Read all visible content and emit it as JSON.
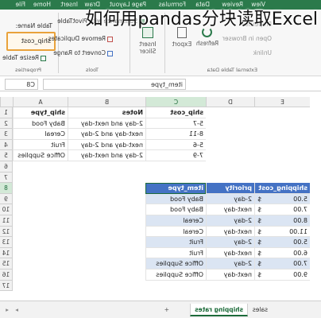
{
  "ribbon": {
    "tabs": [
      "File",
      "Home",
      "Insert",
      "Draw",
      "Page Layout",
      "Formulas",
      "Data",
      "Review",
      "View"
    ],
    "groups": {
      "properties": {
        "label": "Properties",
        "table_name_label": "Table Name:",
        "table_name_value": "ship_cost",
        "resize": "Resize Table"
      },
      "tools": {
        "label": "Tools",
        "summarize": "Summarize with PivotTable",
        "remove_dup": "Remove Duplicates",
        "convert": "Convert to Range"
      },
      "insert_slicer": "Insert Slicer",
      "external": {
        "label": "External Table Data",
        "export": "Export",
        "refresh": "Refresh",
        "properties": "Properties",
        "open_browser": "Open in Browser",
        "unlink": "Unlink"
      }
    }
  },
  "formula_bar": {
    "name_box": "C8",
    "content": "item_type"
  },
  "columns": [
    "A",
    "B",
    "C",
    "D",
    "E"
  ],
  "rows": [
    "1",
    "2",
    "3",
    "4",
    "5",
    "6",
    "7",
    "8",
    "9",
    "10",
    "11",
    "12",
    "13",
    "14",
    "15",
    "16",
    "17"
  ],
  "table1": {
    "headers": [
      "ship_type",
      "Notes",
      "ship_cost"
    ],
    "rows": [
      [
        "Baby Food",
        "2-day and next-day",
        "5-7"
      ],
      [
        "Cereal",
        "next-day and 2-day",
        "8-11"
      ],
      [
        "Fruit",
        "next-day and 2-day",
        "5-6"
      ],
      [
        "Office Supplies",
        "2-day and next-day",
        "7-9"
      ]
    ]
  },
  "table2": {
    "headers": [
      "item_type",
      "priority",
      "shipping_cost"
    ],
    "rows": [
      [
        "Baby Food",
        "2-day",
        "$",
        "5.00"
      ],
      [
        "Baby Food",
        "next-day",
        "$",
        "7.00"
      ],
      [
        "Cereal",
        "2-day",
        "$",
        "8.00"
      ],
      [
        "Cereal",
        "next-day",
        "$",
        "11.00"
      ],
      [
        "Fruit",
        "2-day",
        "$",
        "5.00"
      ],
      [
        "Fruit",
        "next-day",
        "$",
        "6.00"
      ],
      [
        "Office Supplies",
        "2-day",
        "$",
        "7.00"
      ],
      [
        "Office Supplies",
        "next-day",
        "$",
        "9.00"
      ]
    ]
  },
  "sheets": {
    "active": "shipping rates",
    "other": "sales",
    "add": "+"
  },
  "overlay_title": "如何用pandas分块读取Excel"
}
